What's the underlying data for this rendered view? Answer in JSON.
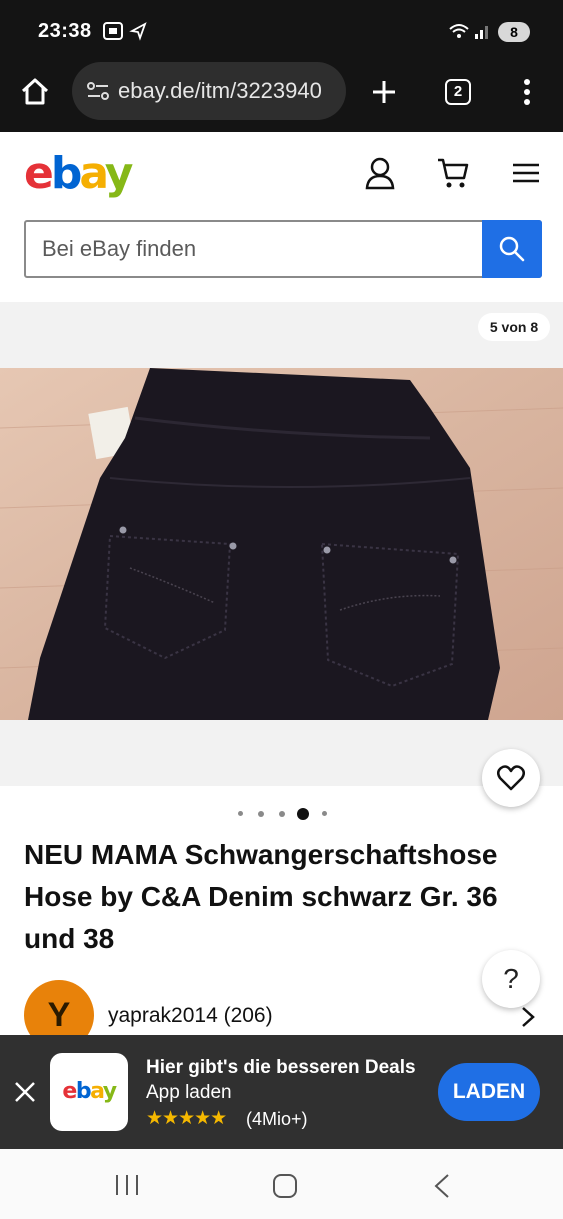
{
  "status_bar": {
    "time": "23:38",
    "battery": "8"
  },
  "browser": {
    "url": "ebay.de/itm/3223940",
    "tab_count": "2"
  },
  "search": {
    "placeholder": "Bei eBay finden"
  },
  "gallery": {
    "counter": "5 von 8",
    "dot_count": 5,
    "active_dot": 3
  },
  "product": {
    "title": "NEU MAMA Schwangerschaftshose Hose by C&A Denim schwarz Gr. 36 und 38"
  },
  "seller": {
    "initial": "Y",
    "name": "yaprak2014 (206)"
  },
  "app_banner": {
    "headline": "Hier gibt's die besseren Deals",
    "subline": "App laden",
    "stars": "★★★★★",
    "rating_count": "(4Mio+)",
    "button_label": "LADEN"
  },
  "colors": {
    "ebay_red": "#e53238",
    "ebay_blue": "#0064d2",
    "ebay_yellow": "#f5af02",
    "ebay_green": "#86b817",
    "accent_blue": "#1f6fe5"
  }
}
